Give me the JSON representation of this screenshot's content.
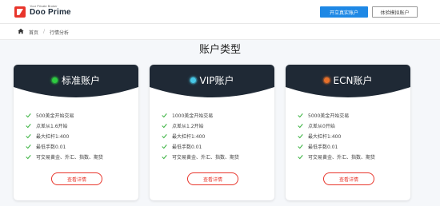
{
  "header": {
    "logo_tagline": "Your Private Broker",
    "logo_name": "Doo Prime",
    "btn_live": "开立真实账户",
    "btn_demo": "体验模拟账户"
  },
  "breadcrumb": {
    "home": "首页",
    "separator": "/",
    "current": "行情分析"
  },
  "section_title": "账户类型",
  "cards": [
    {
      "name": "标准账户",
      "dot_color": "#2ecc40",
      "features": [
        "500美金开始交易",
        "点差从1.6开始",
        "最大杠杆1:400",
        "最低手数0.01",
        "可交易黄金、外汇、指数、期货"
      ],
      "button": "查看详情"
    },
    {
      "name": "VIP账户",
      "dot_color": "#48c9e8",
      "features": [
        "1000美金开始交易",
        "点差从1.2开始",
        "最大杠杆1:400",
        "最低手数0.01",
        "可交易黄金、外汇、指数、期货"
      ],
      "button": "查看详情"
    },
    {
      "name": "ECN账户",
      "dot_color": "#e8702a",
      "features": [
        "5000美金开始交易",
        "点差从0开始",
        "最大杠杆1:400",
        "最低手数0.01",
        "可交易黄金、外汇、指数、期货"
      ],
      "button": "查看详情"
    }
  ],
  "colors": {
    "card_header": "#1f2935",
    "accent_red": "#e8352b",
    "check_green": "#43b649",
    "primary_blue": "#1e88e5"
  }
}
